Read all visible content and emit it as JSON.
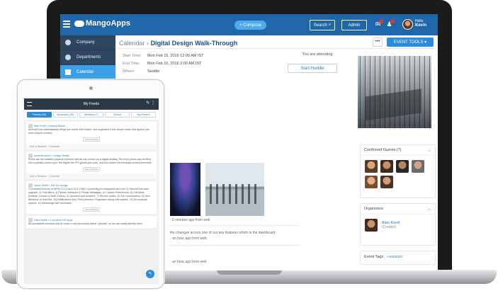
{
  "app": {
    "logo_text": "MangoApps",
    "compose_label": "+ Compose",
    "search_label": "Search",
    "admin_label": "Admin",
    "greeting": "Hello",
    "user_name": "Kevin"
  },
  "sidebar": {
    "items": [
      {
        "label": "Company",
        "icon": "globe-icon"
      },
      {
        "label": "Departments",
        "icon": "building-icon"
      },
      {
        "label": "Calendar",
        "icon": "calendar-icon",
        "active": true
      }
    ]
  },
  "event": {
    "breadcrumb_root": "Calendar",
    "breadcrumb_sep": "›",
    "title": "Digital Design Walk-Through",
    "more_label": "•••",
    "tools_label": "EVENT TOOLS ▾",
    "start_label": "Start Time:",
    "start_value": "Mon Feb 15, 2016 12:00 AM IST",
    "end_label": "End Time:",
    "end_value": "Mon Feb 15, 2016 3:00 AM IST",
    "where_label": "Where:",
    "where_value": "Seattle",
    "attending_text": "You are attending",
    "huddle_label": "Start Huddle"
  },
  "feed": {
    "post1_time": "· 0 minutes ago from web",
    "post2_text": "the changes across one of our key features which is the dashboard",
    "post2_time": "· an hour ago from web",
    "post3_time": "· an hour ago from web",
    "post4_time": "· an hour ago from web"
  },
  "right_panel": {
    "guests_title": "Confirmed Guests (7)",
    "organizers_title": "Organizers",
    "organizer_name": "Alan Knott",
    "organizer_role": "(Creator)",
    "tags_title": "Event Tags",
    "tags_add": "+ADD/EDIT"
  },
  "tablet": {
    "title": "My Feeds",
    "tabs": [
      "Primary (16)",
      "Secondary (18)",
      "Mentions (7)",
      "Pinned",
      "My Feeds ▾"
    ],
    "post1_author": "Alan Knott > Android Studio",
    "post1_text": "Android Auto automatically brings you useful information, and organizes it into simple cards that appear just when they're needed.",
    "post2_author": "Amanda stone > Design Studio",
    "post2_text": "Pixels are the smallest physical element that we can control on a digital display. The more pixels can be fitted into a specific screen size, the higher the PPI (pixels-per-inch), and the clearer the windows content becomes.",
    "post3_author": "Jason Smith > MS 2A Lounge",
    "post3_text": "Connected a bunch of MFW 11.0.0 and 11.0.1 MAC connecting to mangoteol.dev.com: 1) Manual and auto upgrade, 2) Post filters, 3) Pinned, Mentions & Private Messages, 4) Custom Preferences, 5) Poll fields (Default, Custom & Multi Choice), 6) Question and Answers, 7) Record replies, 8) Sort conversation, 9) User Mentions on feed list, 10) Notifications bar / Feed preview / Pagination along with actions, 11) All compose options, 11) Messenger tab verification",
    "post4_author": "Clara Smith > LuxCarrie iOS Apps",
    "post4_text": "All uploadable products will be under a new taxonomy called \"uploads\" so we can easily identify them.",
    "view_full_post": "View Full Post",
    "react_label": "Add a Reaction · Comment"
  }
}
